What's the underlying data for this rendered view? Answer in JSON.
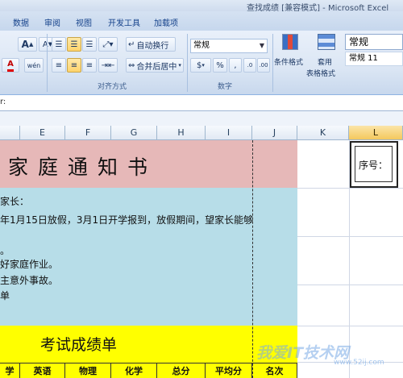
{
  "window": {
    "title": "查找成绩 [兼容模式] - Microsoft Excel"
  },
  "tabs": [
    {
      "label": "数据"
    },
    {
      "label": "审阅"
    },
    {
      "label": "视图"
    },
    {
      "label": "开发工具"
    },
    {
      "label": "加载项"
    }
  ],
  "ribbon": {
    "font": {
      "grow_label": "A",
      "shrink_label": "A",
      "color_label": "A",
      "phonetic_label": "wén"
    },
    "alignment": {
      "wrap_text": "自动换行",
      "merge_center": "合并后居中",
      "group_label": "对齐方式"
    },
    "number": {
      "format_value": "常规",
      "percent": "%",
      "comma": ",",
      "group_label": "数字",
      "currency": "$"
    },
    "styles": {
      "conditional_format": "条件格式",
      "format_as_table": "套用",
      "format_as_table_2": "表格格式",
      "style_normal": "常规",
      "style_normal_2": "常规 11"
    }
  },
  "formula_bar": {
    "fx_label": "r:"
  },
  "columns": [
    {
      "label": "E"
    },
    {
      "label": "F"
    },
    {
      "label": "G"
    },
    {
      "label": "H"
    },
    {
      "label": "I"
    },
    {
      "label": "J"
    },
    {
      "label": "K"
    },
    {
      "label": "L"
    }
  ],
  "sheet": {
    "heading": "家庭通知书",
    "lines": [
      "家长：",
      "年1月15日放假，3月1日开学报到，放假期间，望家长能够",
      "。",
      "好家庭作业。",
      "主意外事故。",
      "单"
    ],
    "score_title": "考试成绩单",
    "table_headers": [
      "学",
      "英语",
      "物理",
      "化学",
      "总分",
      "平均分",
      "名次"
    ],
    "serial_label": "序号："
  },
  "watermark": {
    "text": "我爱IT技术网",
    "url": "www.52ij.com"
  },
  "colors": {
    "header_fill": "#e6b8b8",
    "body_fill": "#b7dde8",
    "table_fill": "#ffff00",
    "ribbon": "#dbe6f4"
  }
}
